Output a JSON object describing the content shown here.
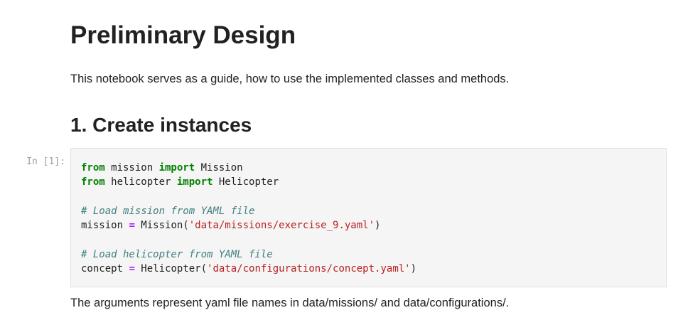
{
  "title": "Preliminary Design",
  "intro": "This notebook serves as a guide, how to use the implemented classes and methods.",
  "section_heading": "1. Create instances",
  "cell": {
    "prompt": "In [1]:",
    "lines": {
      "l1": {
        "kw1": "from",
        "mod": " mission ",
        "kw2": "import",
        "name": " Mission"
      },
      "l2": {
        "kw1": "from",
        "mod": " helicopter ",
        "kw2": "import",
        "name": " Helicopter"
      },
      "l4": {
        "comment": "# Load mission from YAML file"
      },
      "l5": {
        "var": "mission ",
        "op": "=",
        "call": " Mission(",
        "str": "'data/missions/exercise_9.yaml'",
        "close": ")"
      },
      "l7": {
        "comment": "# Load helicopter from YAML file"
      },
      "l8": {
        "var": "concept ",
        "op": "=",
        "call": " Helicopter(",
        "str": "'data/configurations/concept.yaml'",
        "close": ")"
      }
    }
  },
  "outro": "The arguments represent yaml file names in data/missions/ and data/configurations/."
}
